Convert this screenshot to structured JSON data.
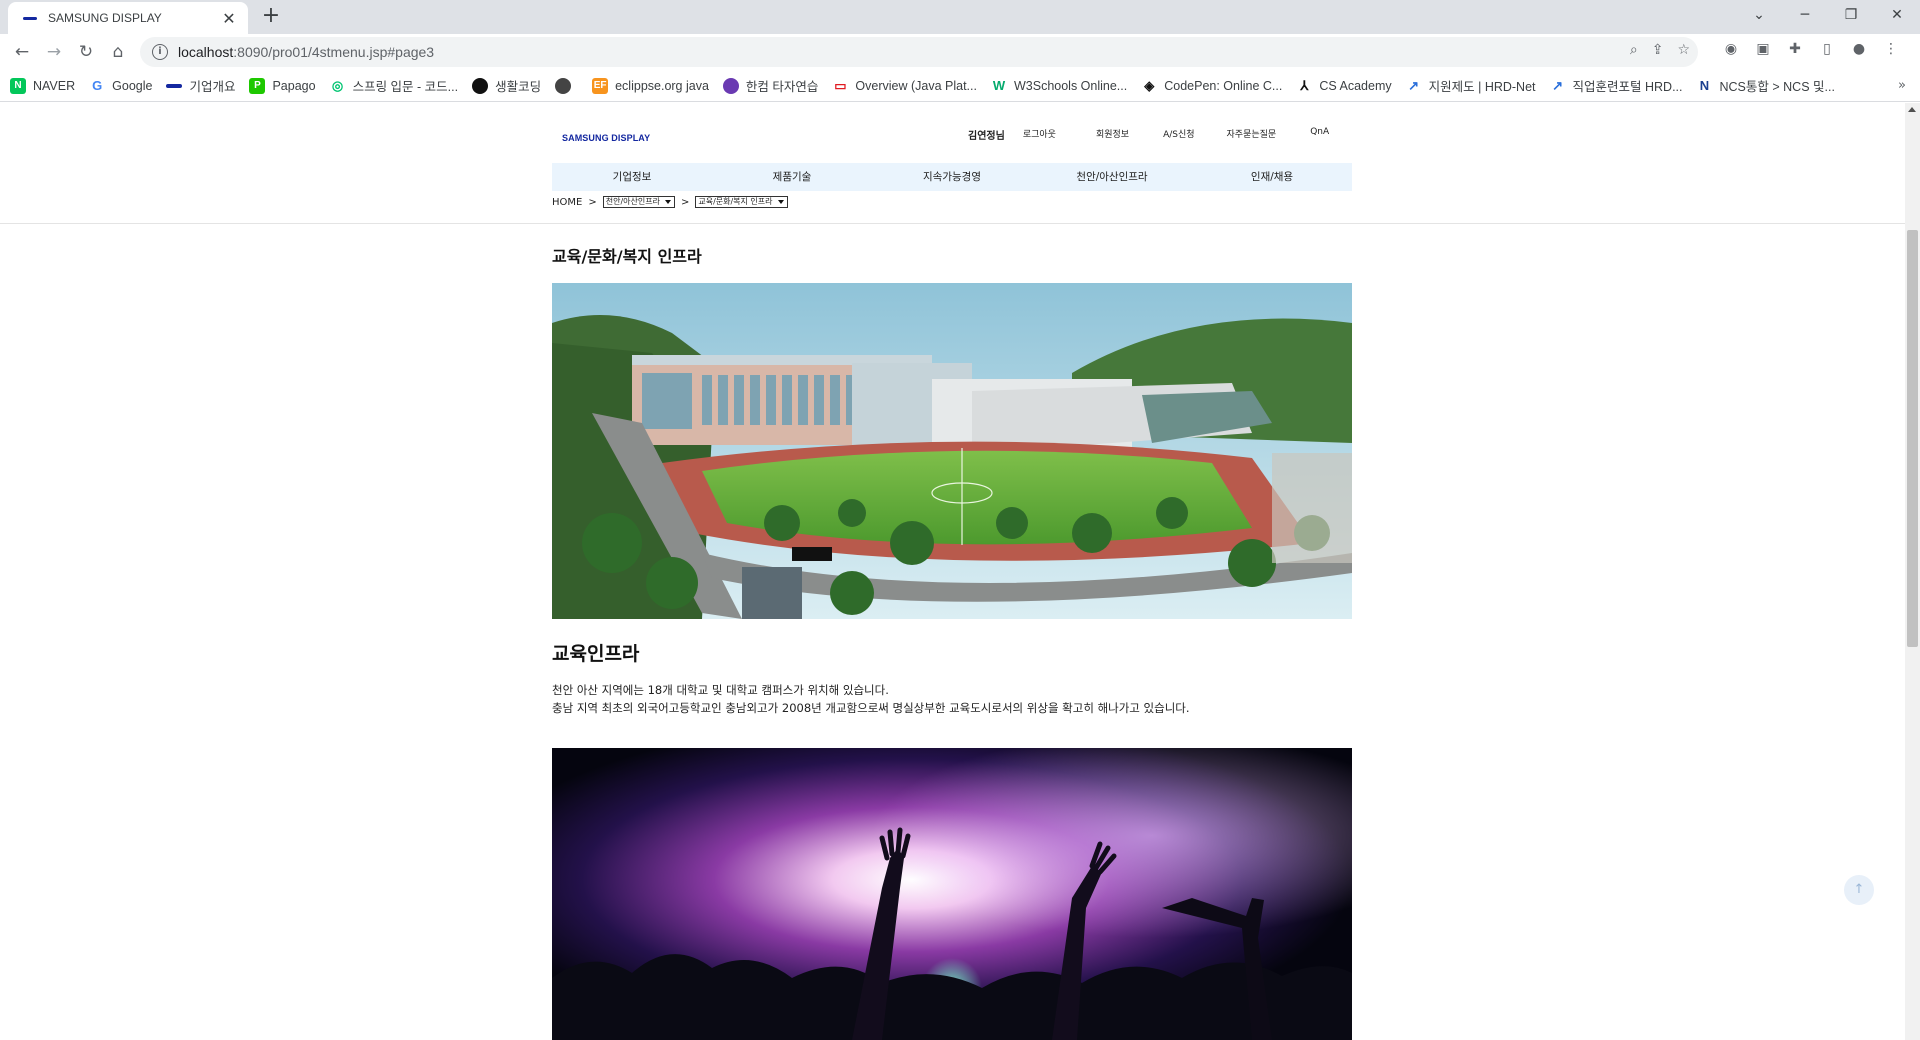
{
  "browser": {
    "tab_title": "SAMSUNG DISPLAY",
    "url_host": "localhost",
    "url_rest": ":8090/pro01/4stmenu.jsp#page3"
  },
  "bookmarks": [
    {
      "label": "NAVER",
      "icon": "naver-icon",
      "color": "#03c75a",
      "glyph": "N"
    },
    {
      "label": "Google",
      "icon": "google-icon",
      "color": "#4285f4",
      "glyph": "G"
    },
    {
      "label": "기업개요",
      "icon": "samsung-icon",
      "color": "#1428a0",
      "glyph": ""
    },
    {
      "label": "Papago",
      "icon": "papago-icon",
      "color": "#1ec800",
      "glyph": "P"
    },
    {
      "label": "스프링 입문 - 코드...",
      "icon": "inflearn-icon",
      "color": "#00c471",
      "glyph": "◎"
    },
    {
      "label": "생활코딩",
      "icon": "opentutorials-icon",
      "color": "#111111",
      "glyph": ""
    },
    {
      "label": "",
      "icon": "globe-icon",
      "color": "#444444",
      "glyph": ""
    },
    {
      "label": "eclippse.org java",
      "icon": "eclipse-icon",
      "color": "#f7941e",
      "glyph": "EF"
    },
    {
      "label": "한컴 타자연습",
      "icon": "hancom-icon",
      "color": "#6a3ab2",
      "glyph": ""
    },
    {
      "label": "Overview (Java Plat...",
      "icon": "oracle-icon",
      "color": "#e11b22",
      "glyph": "▭"
    },
    {
      "label": "W3Schools Online...",
      "icon": "w3schools-icon",
      "color": "#04aa6d",
      "glyph": "W"
    },
    {
      "label": "CodePen: Online C...",
      "icon": "codepen-icon",
      "color": "#111111",
      "glyph": "◈"
    },
    {
      "label": "CS Academy",
      "icon": "csacademy-icon",
      "color": "#111111",
      "glyph": "⅄"
    },
    {
      "label": "지원제도 | HRD-Net",
      "icon": "hrdnet-icon",
      "color": "#2a6fdb",
      "glyph": "↗"
    },
    {
      "label": "직업훈련포털 HRD...",
      "icon": "hrdnet-icon",
      "color": "#2a6fdb",
      "glyph": "↗"
    },
    {
      "label": "NCS통합 > NCS 및...",
      "icon": "ncs-icon",
      "color": "#1b3f8f",
      "glyph": "N"
    }
  ],
  "site": {
    "logo": "SAMSUNG DISPLAY",
    "user_name": "김연정님",
    "util_nav": [
      "로그아웃",
      "회원정보",
      "A/S신청",
      "자주묻는질문",
      "QnA"
    ],
    "gnb": [
      "기업정보",
      "제품기술",
      "지속가능경영",
      "천안/아산인프라",
      "인재/채용"
    ],
    "breadcrumb": {
      "home": "HOME",
      "sep": ">",
      "select1": "천안/아산인프라",
      "select2": "교육/문화/복지 인프라"
    }
  },
  "content": {
    "page_title": "교육/문화/복지 인프라",
    "section_title": "교육인프라",
    "desc_line1": "천안 아산 지역에는 18개 대학교 및 대학교 캠퍼스가 위치해 있습니다.",
    "desc_line2": "충남 지역 최초의 외국어고등학교인 충남외고가 2008년 개교함으로써 명실상부한 교육도시로서의 위상을 확고히 해나가고 있습니다.",
    "top_button": "↑"
  }
}
